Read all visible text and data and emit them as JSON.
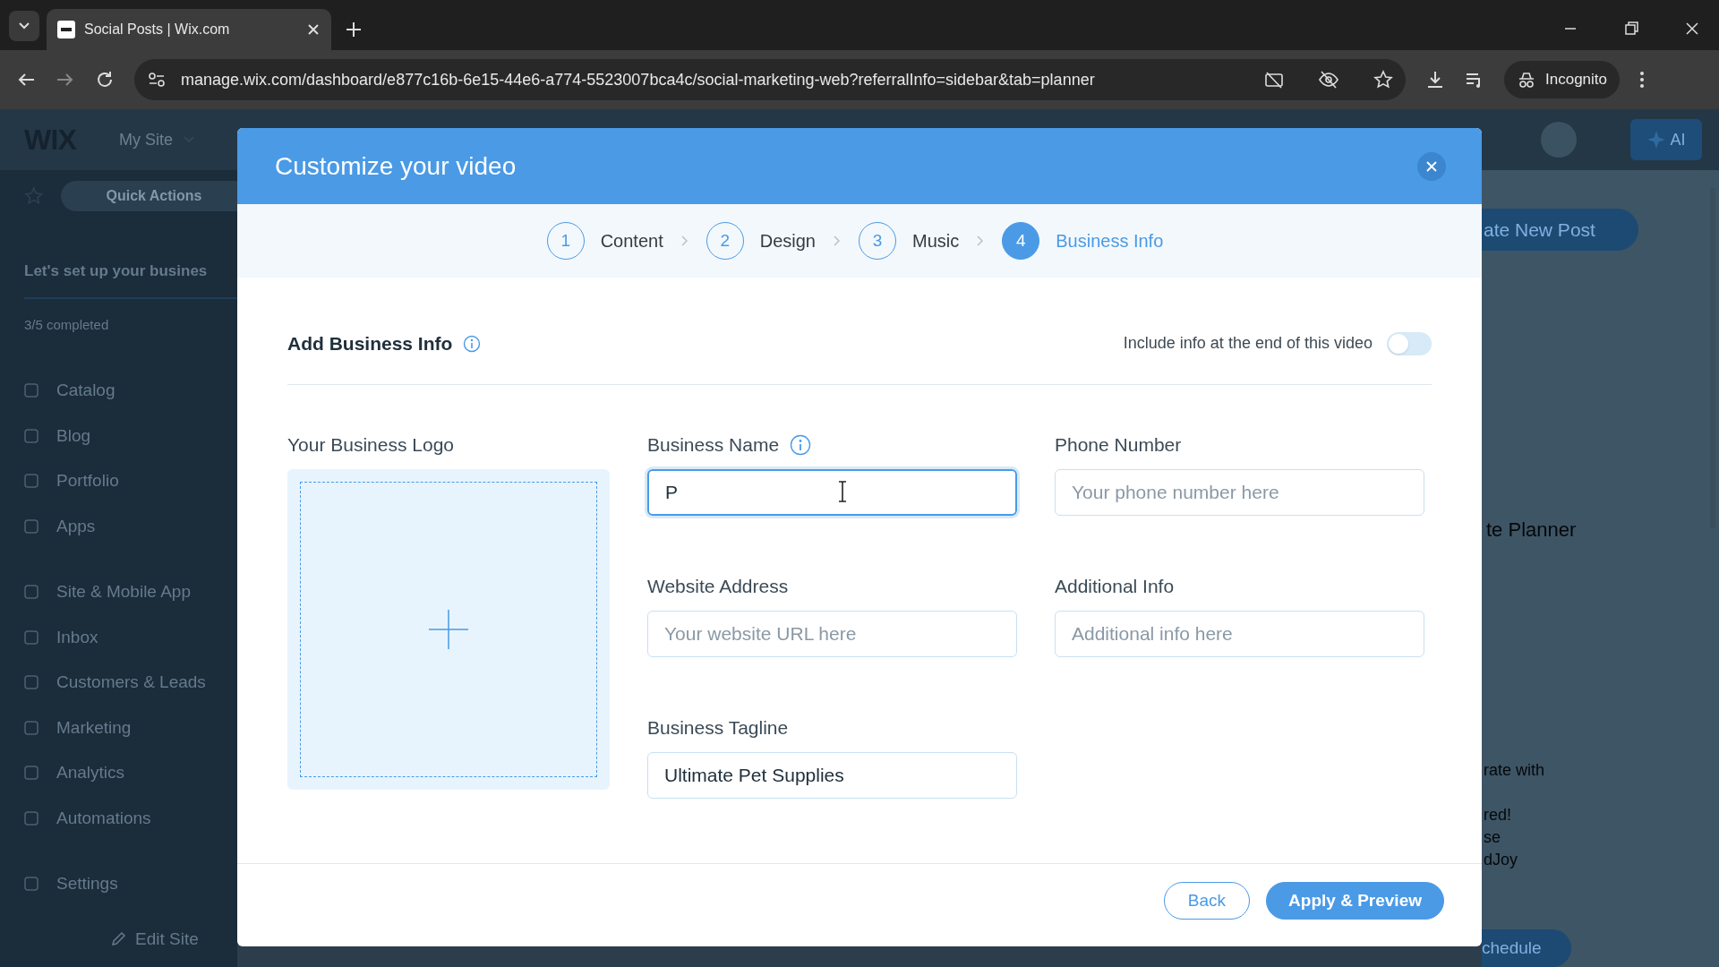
{
  "browser": {
    "tab_title": "Social Posts | Wix.com",
    "url": "manage.wix.com/dashboard/e877c16b-6e15-44e6-a774-5523007bca4c/social-marketing-web?referralInfo=sidebar&tab=planner",
    "profile": "Incognito"
  },
  "dashboard": {
    "logo": "WIX",
    "site_menu": "My Site",
    "ai_button": "AI",
    "quick_actions": "Quick Actions",
    "setup_title": "Let's set up your busines",
    "setup_progress": "3/5 completed",
    "nav_groups": [
      [
        "Catalog",
        "Blog",
        "Portfolio",
        "Apps"
      ],
      [
        "Site & Mobile App",
        "Inbox",
        "Customers & Leads",
        "Marketing",
        "Analytics",
        "Automations"
      ],
      [
        "Settings"
      ]
    ],
    "edit_site": "Edit Site",
    "right_texts": {
      "create_button": "ate New Post",
      "planner_title": "te Planner",
      "lines": [
        "rate with",
        "red!",
        "se",
        "dJoy"
      ],
      "schedule_button": "chedule"
    }
  },
  "dialog": {
    "title": "Customize your video",
    "steps": [
      {
        "number": "1",
        "label": "Content",
        "selected": false
      },
      {
        "number": "2",
        "label": "Design",
        "selected": false
      },
      {
        "number": "3",
        "label": "Music",
        "selected": false
      },
      {
        "number": "4",
        "label": "Business Info",
        "selected": true
      }
    ],
    "section_title": "Add Business Info",
    "include_label": "Include info at the end of this video",
    "include_on": false,
    "logo_label": "Your Business Logo",
    "fields": [
      {
        "label": "Business Name",
        "info": true,
        "value": "P",
        "focused": true
      },
      {
        "label": "Phone Number",
        "info": false,
        "placeholder": "Your phone number here",
        "focused": false
      },
      {
        "label": "Website Address",
        "info": false,
        "placeholder": "Your website URL here",
        "focused": false
      },
      {
        "label": "Additional Info",
        "info": false,
        "placeholder": "Additional info here",
        "focused": false
      },
      {
        "label": "Business Tagline",
        "info": false,
        "value": "Ultimate Pet Supplies",
        "focused": false
      }
    ],
    "buttons": [
      {
        "label": "Back",
        "kind": "secondary"
      },
      {
        "label": "Apply & Preview",
        "kind": "primary"
      }
    ]
  }
}
